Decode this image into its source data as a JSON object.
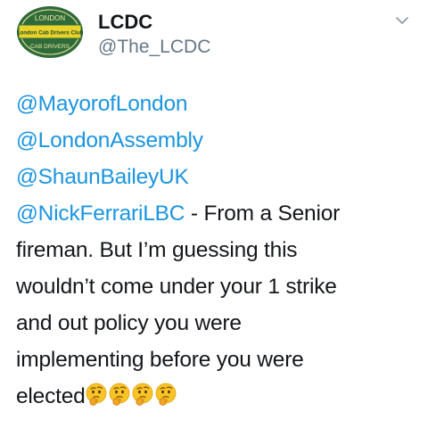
{
  "account": {
    "display_name": "LCDC",
    "handle": "@The_LCDC",
    "logo_text": {
      "top": "LONDON",
      "middle": "London Cab Drivers Club",
      "bottom": "CAB DRIVERS"
    }
  },
  "tweet": {
    "mentions": [
      "@MayorofLondon",
      "@LondonAssembly",
      "@ShaunBaileyUK",
      "@NickFerrariLBC"
    ],
    "line4_rest": " - From a Senior",
    "lines": [
      "fireman.  But I’m guessing this",
      "wouldn’t come under your 1 strike",
      "and out policy you were",
      "implementing before you were"
    ],
    "last_word": "elected",
    "emoji_count": 4
  },
  "icons": {
    "chevron": "chevron-down-icon",
    "emoji": "thinking-face-emoji"
  },
  "colors": {
    "mention": "#1b95e0",
    "text": "#14171a",
    "handle": "#657786",
    "logo_green": "#2f6b3a",
    "logo_yellow": "#e9d32a"
  }
}
